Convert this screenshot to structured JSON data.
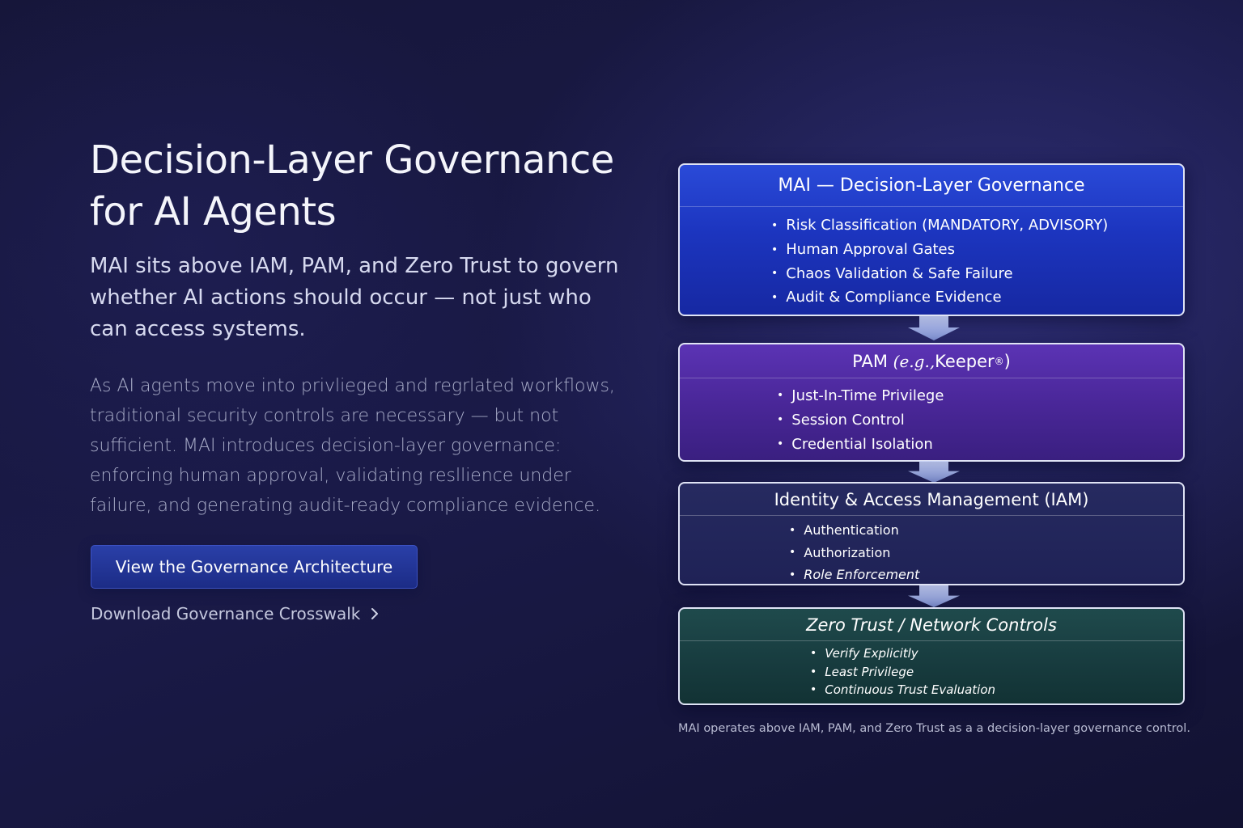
{
  "hero": {
    "title_line1": "Decision-Layer Governance",
    "title_line2": "for AI Agents",
    "subtitle": "MAI sits above IAM, PAM, and Zero Trust to govern whether AI actions should occur — not just who can access systems.",
    "body": "As AI agents move into privlieged and regrlated workflows, traditional security controls are necessary — but not sufficient. MAI introduces decision-layer governance: enforcing human approval, validating resllience under failure, and generating audit-ready compliance evidence.",
    "primary_button": "View the Governance Architecture",
    "secondary_link": "Download Governance Crosswalk"
  },
  "diagram": {
    "layers": [
      {
        "title": "MAI — Decision-Layer Governance",
        "items": [
          "Risk Classification (MANDATORY, ADVISORY)",
          "Human Approval Gates",
          "Chaos Validation & Safe Failure",
          "Audit & Compliance Evidence"
        ],
        "color": "#1f38c4"
      },
      {
        "title_prefix": "PAM ",
        "title_italic": "(e.g.,",
        "title_suffix": " Keeper",
        "title_mark": "®",
        "title_close": ")",
        "items": [
          "Just-In-Time Privilege",
          "Session Control",
          "Credential Isolation"
        ],
        "color": "#4a2799"
      },
      {
        "title": "Identity & Access Management (IAM)",
        "items": [
          "Authentication",
          "Authorization",
          "Role Enforcement"
        ],
        "color": "#22265a"
      },
      {
        "title": "Zero Trust / Network Controls",
        "items": [
          "Verify Explicitly",
          "Least Privilege",
          "Continuous Trust Evaluation"
        ],
        "color": "#1a4144"
      }
    ],
    "bullet": "•",
    "caption": "MAI operates above IAM, PAM, and Zero Trust as a a decision-layer governance control."
  },
  "icons": {
    "link_icon": "chevron-right-icon",
    "connector_icon": "arrow-down-icon"
  }
}
